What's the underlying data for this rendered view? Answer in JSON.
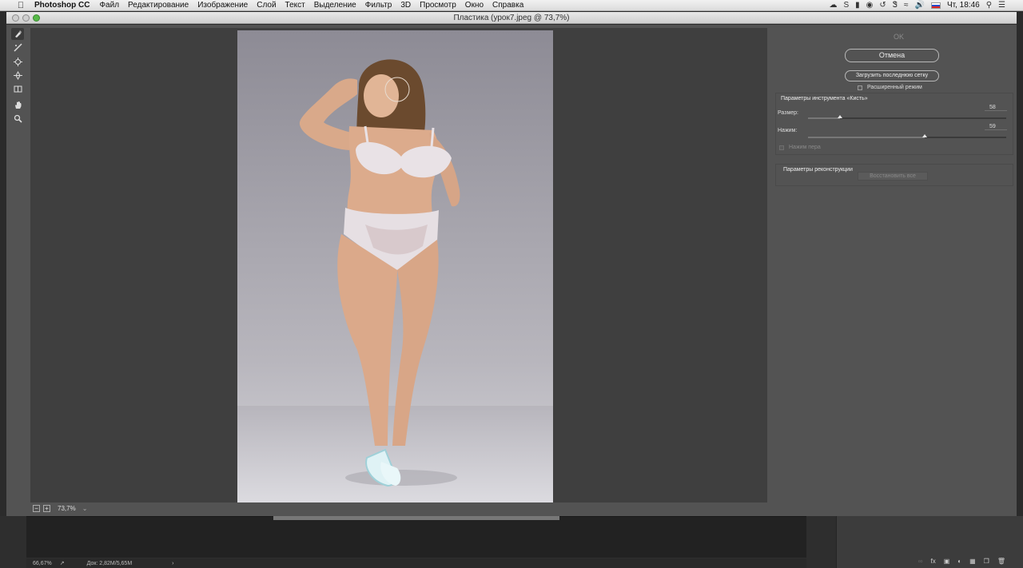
{
  "menubar": {
    "app_name": "Photoshop CC",
    "items": [
      "Файл",
      "Редактирование",
      "Изображение",
      "Слой",
      "Текст",
      "Выделение",
      "Фильтр",
      "3D",
      "Просмотр",
      "Окно",
      "Справка"
    ],
    "clock": "Чт, 18:46"
  },
  "window": {
    "title": "Пластика (урок7.jpeg @ 73,7%)"
  },
  "preview": {
    "zoom": "73,7%"
  },
  "panel": {
    "ok_label": "OK",
    "cancel_label": "Отмена",
    "load_mesh_label": "Загрузить последнюю сетку",
    "advanced_mode_label": "Расширенный режим",
    "brush_section_title": "Параметры инструмента «Кисть»",
    "size_label": "Размер:",
    "size_value": "58",
    "size_fraction": 0.16,
    "pressure_label": "Нажим:",
    "pressure_value": "59",
    "pressure_fraction": 0.59,
    "pen_pressure_label": "Нажим пера",
    "recon_section_title": "Параметры реконструкции",
    "restore_all_label": "Восстановить все"
  },
  "statusbar": {
    "zoom": "66,67%",
    "doc": "Док: 2,82M/5,65M"
  },
  "colors": {
    "dialog_bg": "#535353",
    "preview_bg": "#3f3f3f",
    "panel_text": "#dddddd"
  }
}
